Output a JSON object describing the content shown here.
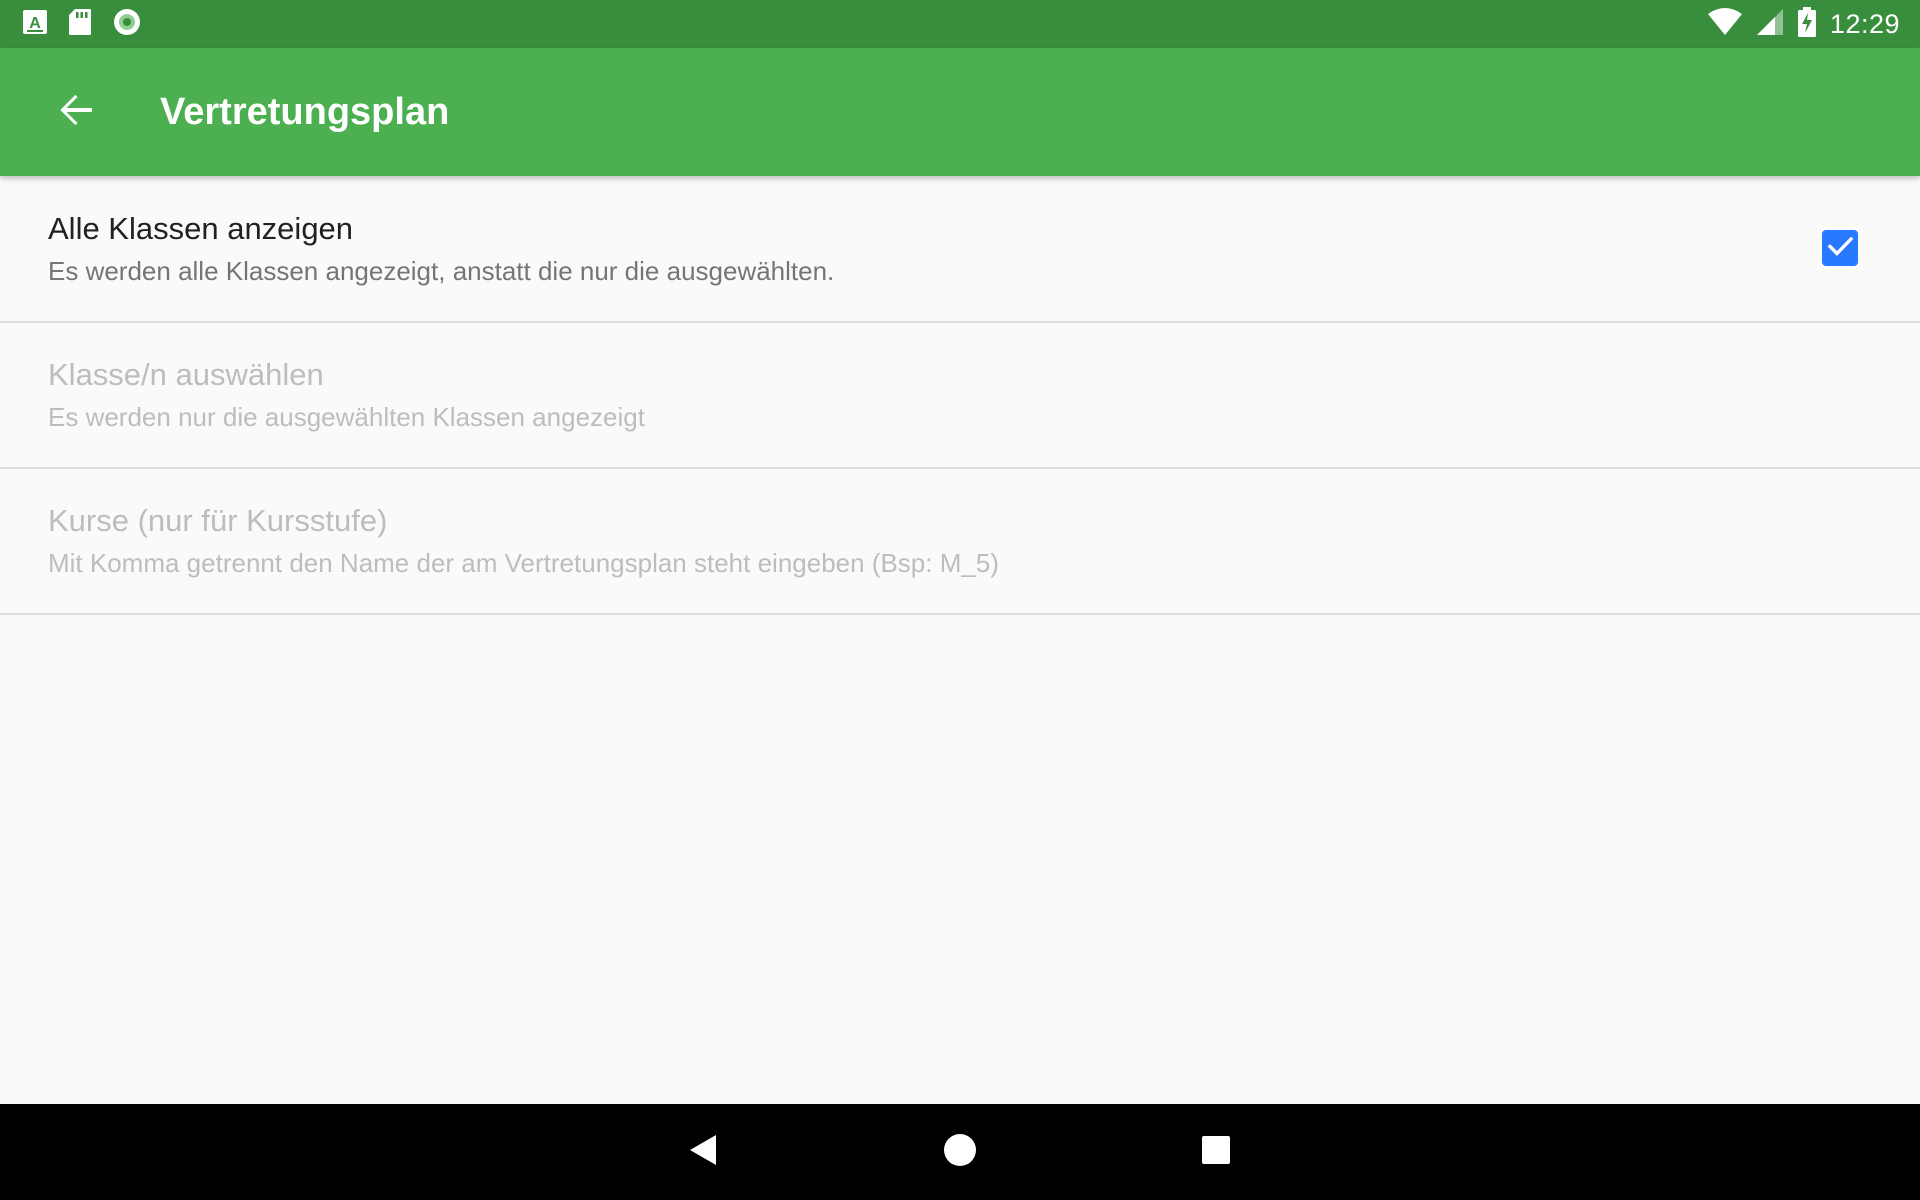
{
  "status_bar": {
    "time": "12:29",
    "left_icons": [
      "a-notification-icon",
      "sd-card-icon",
      "record-circle-icon"
    ],
    "right_icons": [
      "wifi-icon",
      "cell-signal-icon",
      "battery-charging-icon"
    ]
  },
  "app_bar": {
    "title": "Vertretungsplan",
    "back_icon": "arrow-back-icon"
  },
  "preferences": [
    {
      "title": "Alle Klassen anzeigen",
      "summary": "Es werden alle Klassen angezeigt, anstatt die nur die ausgewählten.",
      "enabled": true,
      "checkbox_checked": true
    },
    {
      "title": "Klasse/n auswählen",
      "summary": "Es werden nur die ausgewählten Klassen angezeigt",
      "enabled": false
    },
    {
      "title": "Kurse (nur für Kursstufe)",
      "summary": "Mit Komma getrennt den Name der am Vertretungsplan steht eingeben (Bsp: M_5)",
      "enabled": false
    }
  ],
  "nav_bar": {
    "icons": [
      "nav-back-icon",
      "nav-home-icon",
      "nav-recents-icon"
    ]
  },
  "colors": {
    "status_bar": "#388e3c",
    "app_bar": "#4caf50",
    "checkbox": "#2979ff",
    "background": "#fafafa"
  }
}
